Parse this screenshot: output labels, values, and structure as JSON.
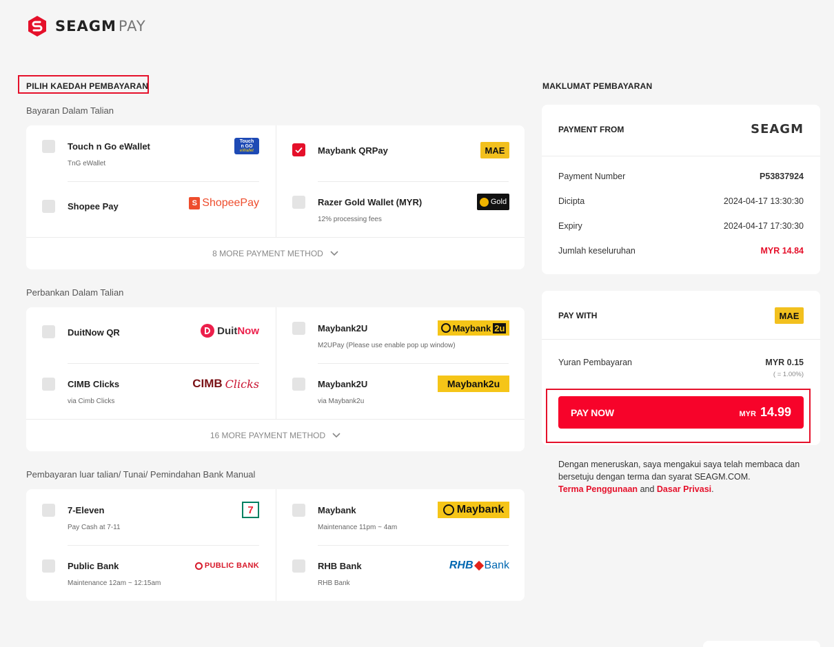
{
  "brand": {
    "name_main": "SEAGM",
    "name_suffix": "PAY"
  },
  "left": {
    "heading": "PILIH KAEDAH PEMBAYARAN",
    "groups": [
      {
        "label": "Bayaran Dalam Talian",
        "items": [
          {
            "name": "Touch n Go eWallet",
            "sub": "TnG eWallet",
            "logo_text": [
              "Touch",
              "n GO",
              "eWallet"
            ],
            "checked": false
          },
          {
            "name": "Shopee Pay",
            "sub": "",
            "logo_text": "ShopeePay",
            "checked": false
          },
          {
            "name": "Maybank QRPay",
            "sub": "",
            "logo_text": "MAE",
            "checked": true
          },
          {
            "name": "Razer Gold Wallet (MYR)",
            "sub": "12% processing fees",
            "logo_text": "Gold",
            "checked": false
          }
        ],
        "more": "8 MORE PAYMENT METHOD"
      },
      {
        "label": "Perbankan Dalam Talian",
        "items": [
          {
            "name": "DuitNow QR",
            "sub": "",
            "logo_text": [
              "Duit",
              "Now"
            ],
            "checked": false
          },
          {
            "name": "CIMB Clicks",
            "sub": "via Cimb Clicks",
            "logo_text": [
              "CIMB",
              "Clicks"
            ],
            "checked": false
          },
          {
            "name": "Maybank2U",
            "sub": "M2UPay (Please use enable pop up window)",
            "logo_text": [
              "Maybank",
              "2u"
            ],
            "checked": false
          },
          {
            "name": "Maybank2U",
            "sub": "via Maybank2u",
            "logo_text": "Maybank2u",
            "checked": false
          }
        ],
        "more": "16 MORE PAYMENT METHOD"
      },
      {
        "label": "Pembayaran luar talian/ Tunai/ Pemindahan Bank Manual",
        "items": [
          {
            "name": "7-Eleven",
            "sub": "Pay Cash at 7-11",
            "logo_text": "7",
            "checked": false
          },
          {
            "name": "Public Bank",
            "sub": "Maintenance 12am ~ 12:15am",
            "logo_text": "PUBLIC BANK",
            "checked": false
          },
          {
            "name": "Maybank",
            "sub": "Maintenance 11pm ~ 4am",
            "logo_text": "Maybank",
            "checked": false
          },
          {
            "name": "RHB Bank",
            "sub": "RHB Bank",
            "logo_text": [
              "RHB",
              "Bank"
            ],
            "checked": false
          }
        ]
      }
    ]
  },
  "right": {
    "heading": "MAKLUMAT PEMBAYARAN",
    "payment_from": {
      "title": "PAYMENT FROM",
      "logo_text": "SEAGM",
      "rows": [
        {
          "label": "Payment Number",
          "value": "P53837924"
        },
        {
          "label": "Dicipta",
          "value": "2024-04-17 13:30:30"
        },
        {
          "label": "Expiry",
          "value": "2024-04-17 17:30:30"
        },
        {
          "label": "Jumlah keseluruhan",
          "value": "MYR 14.84"
        }
      ]
    },
    "pay_with": {
      "title": "PAY WITH",
      "logo_text": "MAE",
      "fee_label": "Yuran Pembayaran",
      "fee_value": "MYR 0.15",
      "fee_rate": "( = 1.00%)",
      "button_label": "PAY NOW",
      "button_currency": "MYR",
      "button_amount": "14.99"
    },
    "terms": {
      "text1": "Dengan meneruskan, saya mengakui saya telah membaca dan bersetuju dengan terma dan syarat SEAGM.COM.",
      "link1": "Terma Penggunaan",
      "and": "and",
      "link2": "Dasar Privasi",
      "end": "."
    }
  },
  "colors": {
    "accent": "#e5102a",
    "button": "#f7032a",
    "mae_yellow": "#f2c01e",
    "maybank_yellow": "#f5c518"
  }
}
